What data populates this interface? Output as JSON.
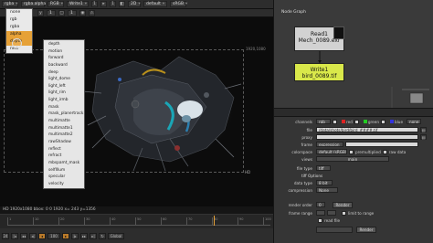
{
  "viewer": {
    "toolbar1": {
      "layer": "rgba",
      "channel_field": "rgba.alpha",
      "colorspace": "RGB",
      "input_a": "Write1",
      "gain": "1",
      "gamma": "1",
      "view_mode": "2D",
      "lut": "default",
      "display": "sRGB"
    },
    "toolbar2": {
      "proxy_label": "y",
      "frame_a": "1",
      "frame_b": "1"
    },
    "layer_menu": [
      "none",
      "rgb",
      "rgba",
      "alpha",
      "depth",
      "new"
    ],
    "layer_menu_selected": "alpha",
    "submenu_items": [
      "depth",
      "motion",
      "forward",
      "backward",
      "deep",
      "light_dome",
      "light_left",
      "light_rim",
      "light_irmb",
      "mask",
      "mask_planertrack",
      "multimatte",
      "multimatte1",
      "multimatte2",
      "rawShadow",
      "reflect",
      "refract",
      "mbspamt_mask",
      "selfIllum",
      "specular",
      "velocity"
    ],
    "format_top": "1920,1080",
    "format_label": "HD",
    "info_bar": "HD 1920x1080  bbox: 0 0 1920   x= 243 y=1356",
    "timeline_ticks": [
      "1",
      "10",
      "20",
      "30",
      "40",
      "50",
      "60",
      "70",
      "80",
      "90",
      "100"
    ],
    "transport": {
      "fps": "24",
      "current_frame": "100",
      "playback_mode": "Global"
    }
  },
  "graph": {
    "tab": "Node Graph",
    "read_node": {
      "name": "Read1",
      "file": "Mech_0089.exr"
    },
    "write_node": {
      "name": "Write1",
      "file": "bird_0089.tif"
    }
  },
  "properties": {
    "channels": {
      "label": "channels",
      "value": "rgb",
      "channels": [
        "red",
        "green",
        "blue",
        "none"
      ]
    },
    "file": {
      "label": "file",
      "value": "/data/shots/bird/bird_####.tif"
    },
    "proxy": {
      "label": "proxy",
      "value": ""
    },
    "frame": {
      "label": "frame",
      "value": "expression"
    },
    "colorspace": {
      "label": "colorspace",
      "value": "default (sRGB)",
      "premultiplied": "premultiplied",
      "raw_data": "raw data"
    },
    "views": {
      "label": "views",
      "value": "main"
    },
    "file_type": {
      "label": "file type",
      "value": "tiff"
    },
    "section": "tiff Options",
    "data_type": {
      "label": "data type",
      "value": "8 bit"
    },
    "compression": {
      "label": "compression",
      "value": "None"
    },
    "render_order": {
      "label": "render order",
      "value": "0",
      "button": "Render"
    },
    "frame_range": {
      "label": "frame range",
      "limit_label": "limit to range"
    },
    "read_file": "read file",
    "bottom_button": "Render"
  },
  "colors": {
    "accent": "#e6a137",
    "write_node": "#d9e84a",
    "read_node": "#d2d2d2"
  }
}
